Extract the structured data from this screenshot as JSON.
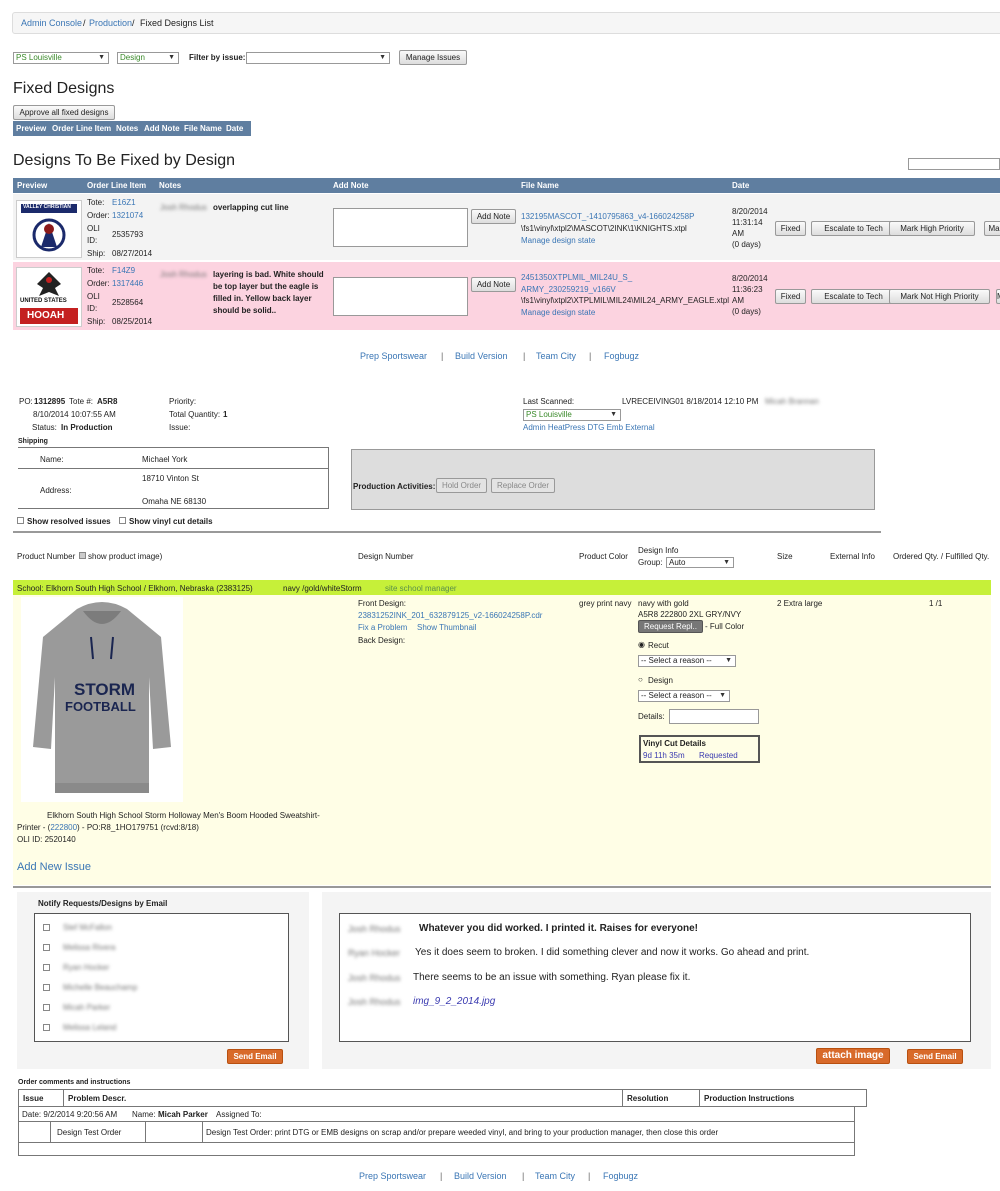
{
  "breadcrumb": {
    "home": "Admin Console",
    "sep1": "/",
    "production": "Production",
    "sep2": "/",
    "current": "Fixed Designs List"
  },
  "filters": {
    "location": "PS Louisville",
    "type": "Design",
    "issue_label": "Filter by issue:",
    "issue_value": "",
    "manage_issues": "Manage Issues"
  },
  "fixed": {
    "title": "Fixed Designs",
    "approve": "Approve all fixed designs",
    "cols": [
      "Preview",
      "Order Line Item",
      "Notes",
      "Add Note",
      "File Name",
      "Date"
    ]
  },
  "to_fix": {
    "title": "Designs To Be Fixed by Design",
    "cols": [
      "Preview",
      "Order Line Item",
      "Notes",
      "Add Note",
      "File Name",
      "Date"
    ],
    "rows": [
      {
        "logo_text": "VALLEY CHRISTIAN",
        "tote_label": "Tote:",
        "tote": "E16Z1",
        "order_label": "Order:",
        "order": "1321074",
        "oli_label": "OLI",
        "id_label": "ID:",
        "oli": "2535793",
        "ship_label": "Ship:",
        "ship": "08/27/2014",
        "note_author": "Josh Rhodus",
        "note": "overlapping cut line",
        "add_note": "Add Note",
        "file": "132195MASCOT_-1410795863_v4-166024258P",
        "path": "\\fs1\\vinyl\\xtpl2\\MASCOT\\2INK\\1\\KNIGHTS.xtpl",
        "manage": "Manage design state",
        "date1": "8/20/2014",
        "date2": "11:31:14",
        "date3": "AM",
        "date4": "(0 days)",
        "fixed": "Fixed",
        "escalate": "Escalate to Tech",
        "priority": "Mark High Priority",
        "more": "Ma"
      },
      {
        "logo_text1": "UNITED STATES",
        "logo_text2": "HOOAH",
        "tote_label": "Tote:",
        "tote": "F14Z9",
        "order_label": "Order:",
        "order": "1317446",
        "oli_label": "OLI",
        "id_label": "ID:",
        "oli": "2528564",
        "ship_label": "Ship:",
        "ship": "08/25/2014",
        "note_author": "Josh Rhodus",
        "note_l1": "layering is bad. White should",
        "note_l2": "be top layer but the eagle is",
        "note_l3": "filled in. Yellow back layer",
        "note_l4": "should be solid..",
        "add_note": "Add Note",
        "file_l1": "2451350XTPLMIL_MIL24U_S_",
        "file_l2": "ARMY_230259219_v166V",
        "path": "\\fs1\\vinyl\\xtpl2\\XTPLMIL\\MIL24\\MIL24_ARMY_EAGLE.xtpl",
        "manage": "Manage design state",
        "date1": "8/20/2014",
        "date2": "11:36:23",
        "date3": "AM",
        "date4": "(0 days)",
        "fixed": "Fixed",
        "escalate": "Escalate to Tech",
        "priority": "Mark Not High Priority",
        "more": "Ma"
      }
    ]
  },
  "footer": {
    "links": [
      "Prep Sportswear",
      "Build Version",
      "Team City",
      "Fogbugz"
    ],
    "sep": "|"
  },
  "order": {
    "po_label": "PO:",
    "po": "1312895",
    "tote_label": "Tote #:",
    "tote": "A5R8",
    "date": "8/10/2014 10:07:55 AM",
    "status_label": "Status:",
    "status": "In Production",
    "priority_label": "Priority:",
    "qty_label": "Total Quantity:",
    "qty": "1",
    "issue_label": "Issue:",
    "last_scanned_label": "Last Scanned:",
    "last_scanned": "LVRECEIVING01 8/18/2014 12:10 PM",
    "last_scanned_user": "Micah Brannan",
    "location": "PS Louisville",
    "links": "Admin HeatPress DTG Emb External",
    "shipping_label": "Shipping",
    "name_label": "Name:",
    "name": "Michael York",
    "address_label": "Address:",
    "addr1": "18710 Vinton St",
    "addr2": "Omaha NE 68130",
    "activities_label": "Production Activities:",
    "hold": "Hold Order",
    "replace": "Replace Order",
    "show_resolved": "Show resolved issues",
    "show_vinyl": "Show vinyl cut details"
  },
  "product_table": {
    "cols": {
      "product": "Product Number",
      "show_img": "show product image)",
      "design": "Design Number",
      "color": "Product Color",
      "info": "Design Info",
      "group_label": "Group:",
      "group": "Auto",
      "size": "Size",
      "ext": "External Info",
      "qty": "Ordered Qty. / Fulfilled Qty."
    },
    "school": "School: Elkhorn South High School / Elkhorn, Nebraska (2383125)",
    "school_colors": "navy /gold/whiteStorm",
    "site_manager": "site school manager",
    "front_label": "Front Design:",
    "front_file": "23831252INK_201_632879125_v2-166024258P.cdr",
    "fix": "Fix a Problem",
    "thumb": "Show Thumbnail",
    "back_label": "Back Design:",
    "color": "grey print navy",
    "info1": "navy with gold",
    "info2": "A5R8 222800 2XL GRY/NVY",
    "request": "Request Repl..",
    "full": "- Full Color",
    "recut": "Recut",
    "reason": "-- Select a reason --",
    "design_opt": "Design",
    "details_label": "Details:",
    "vinyl_title": "Vinyl Cut Details",
    "vinyl_time": "9d 11h 35m",
    "vinyl_status": "Requested",
    "size": "2 Extra large",
    "qty": "1 /1",
    "hoodie_l1": "STORM",
    "hoodie_l2": "FOOTBALL",
    "desc1": "Elkhorn South High School Storm Holloway Men's Boom Hooded Sweatshirt-",
    "desc2a": "Printer - (",
    "desc2b": "222800",
    "desc2c": ") - PO:R8_1HO179751 (rcvd:8/18)",
    "desc3": "OLI ID: 2520140",
    "add_issue": "Add New Issue"
  },
  "notify": {
    "title": "Notify Requests/Designs by Email",
    "people": [
      "Stef McFallon",
      "Melissa Rivera",
      "Ryan Hocker",
      "Michelle Beauchamp",
      "Micah Parker",
      "Melissa Leland"
    ],
    "send": "Send Email"
  },
  "comments": [
    {
      "author": "Josh Rhodus",
      "text": "Whatever you did worked. I printed it. Raises for everyone!"
    },
    {
      "author": "Ryan Hocker",
      "text": "Yes it does seem to broken. I did something clever and now it works. Go ahead and print."
    },
    {
      "author": "Josh Rhodus",
      "text": "There seems to be an issue with something. Ryan please fix it."
    },
    {
      "author": "Josh Rhodus",
      "text": "img_9_2_2014.jpg"
    }
  ],
  "comment_actions": {
    "attach": "attach image",
    "send": "Send Email"
  },
  "instructions": {
    "title": "Order comments and instructions",
    "cols": [
      "Issue",
      "Problem Descr.",
      "Resolution",
      "Production Instructions"
    ],
    "date": "Date: 9/2/2014 9:20:56 AM",
    "name_label": "Name:",
    "name": "Micah Parker",
    "assigned": "Assigned To:",
    "item": "Design Test Order",
    "desc": "Design Test Order: print DTG or EMB designs on scrap and/or prepare weeded vinyl, and bring to your production manager, then close this order"
  }
}
